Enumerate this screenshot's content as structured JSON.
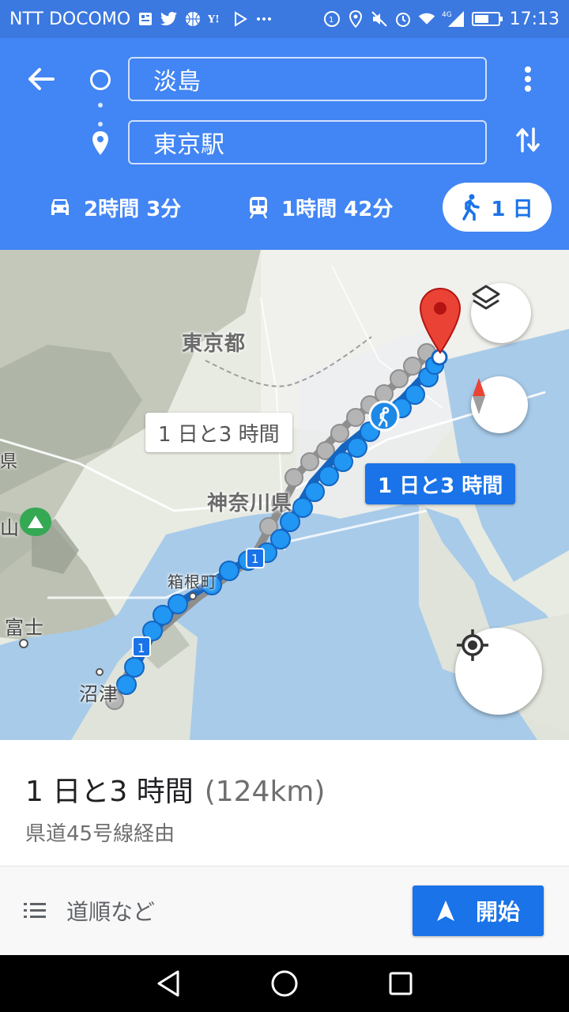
{
  "status_bar": {
    "carrier": "NTT DOCOMO",
    "network": "4G",
    "time": "17:13",
    "left_icons": [
      "news-icon",
      "twitter-icon",
      "basketball-icon",
      "yahoo-icon",
      "play-store-icon",
      "more-dots-icon"
    ],
    "right_icons": [
      "data-saver-icon",
      "location-icon",
      "mute-icon",
      "alarm-icon",
      "wifi-icon",
      "signal-icon",
      "battery-icon"
    ]
  },
  "search": {
    "origin": "淡島",
    "destination": "東京駅"
  },
  "modes": {
    "car": "2時間 3分",
    "transit": "1時間 42分",
    "walk": "1 日"
  },
  "map": {
    "labels": {
      "tokyo": "東京都",
      "kanagawa": "神奈川県",
      "hakone": "箱根町",
      "fuji": "富士",
      "numazu": "沼津",
      "yama": "山",
      "ken": "県"
    },
    "route_badge": "1",
    "alt_route_time": "1 日と3 時間",
    "main_route_time": "1 日と3 時間"
  },
  "summary": {
    "duration": "1 日と3 時間",
    "distance": "(124km)",
    "via": "県道45号線経由"
  },
  "actions": {
    "steps": "道順など",
    "start": "開始"
  },
  "colors": {
    "header": "#4285f4",
    "status_bar": "#3b78e0",
    "route_blue": "#2196f3",
    "route_gray": "#9e9e9e",
    "pin_red": "#ea4335",
    "accent": "#1a73e8"
  }
}
